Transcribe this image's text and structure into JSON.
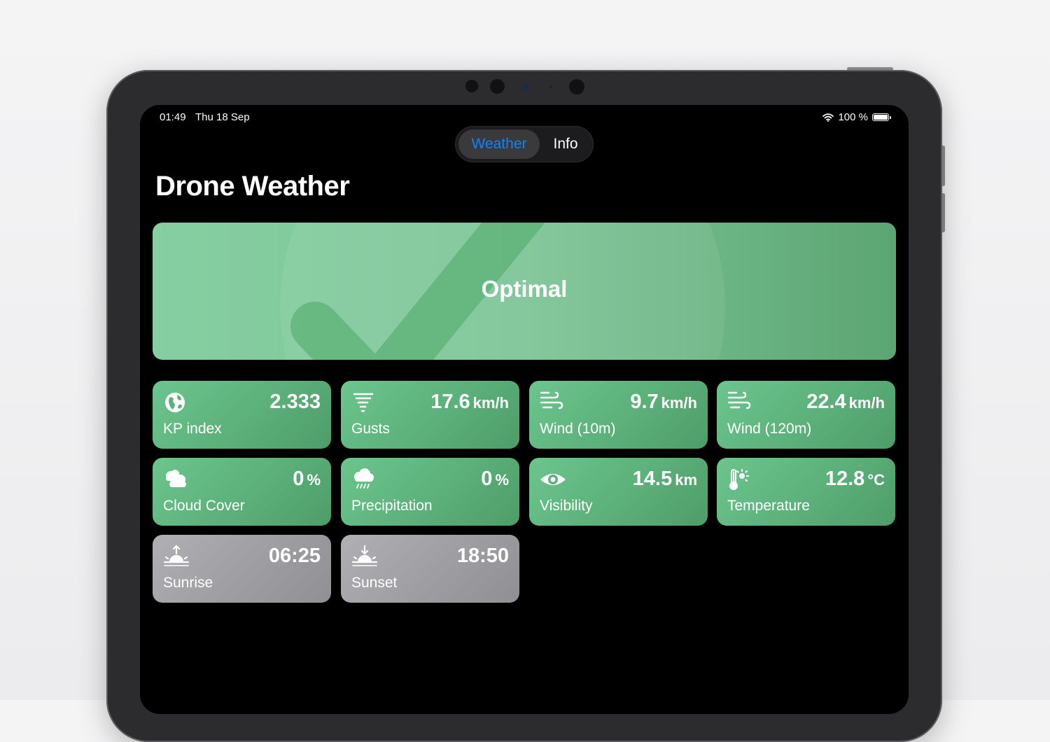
{
  "status_bar": {
    "time": "01:49",
    "date": "Thu 18 Sep",
    "battery_text": "100 %"
  },
  "tabs": {
    "weather": "Weather",
    "info": "Info",
    "selected": "Weather"
  },
  "page_title": "Drone Weather",
  "status_banner": {
    "label": "Optimal",
    "icon": "checkmark-icon",
    "color": "#7cc496"
  },
  "colors": {
    "good": "#5cb079",
    "neutral": "#9e9ea2",
    "accent": "#0a84ff"
  },
  "metrics": [
    {
      "label": "KP index",
      "value": "2.333",
      "unit": "",
      "icon": "globe-icon",
      "state": "good"
    },
    {
      "label": "Gusts",
      "value": "17.6",
      "unit": "km/h",
      "icon": "tornado-icon",
      "state": "good"
    },
    {
      "label": "Wind (10m)",
      "value": "9.7",
      "unit": "km/h",
      "icon": "wind-icon",
      "state": "good"
    },
    {
      "label": "Wind (120m)",
      "value": "22.4",
      "unit": "km/h",
      "icon": "wind-icon",
      "state": "good"
    },
    {
      "label": "Cloud Cover",
      "value": "0",
      "unit": "%",
      "icon": "clouds-icon",
      "state": "good"
    },
    {
      "label": "Precipitation",
      "value": "0",
      "unit": "%",
      "icon": "cloud-rain-icon",
      "state": "good"
    },
    {
      "label": "Visibility",
      "value": "14.5",
      "unit": "km",
      "icon": "eye-icon",
      "state": "good"
    },
    {
      "label": "Temperature",
      "value": "12.8",
      "unit": "°C",
      "icon": "thermometer-sun-icon",
      "state": "good"
    },
    {
      "label": "Sunrise",
      "value": "06:25",
      "unit": "",
      "icon": "sunrise-icon",
      "state": "neutral"
    },
    {
      "label": "Sunset",
      "value": "18:50",
      "unit": "",
      "icon": "sunset-icon",
      "state": "neutral"
    }
  ]
}
